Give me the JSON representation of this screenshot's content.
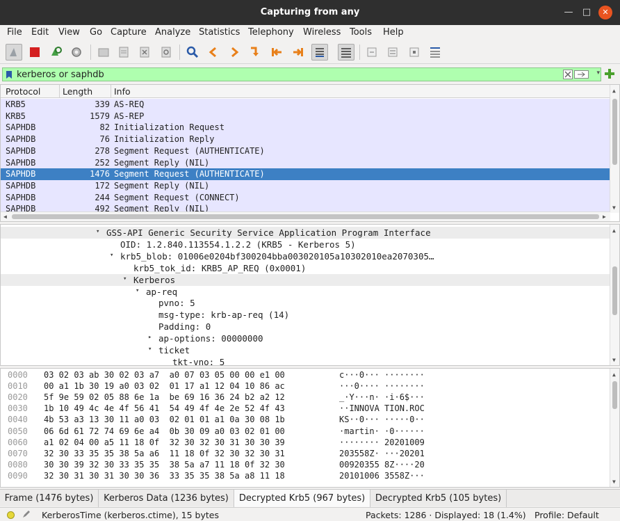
{
  "window": {
    "title": "Capturing from any"
  },
  "menu": [
    "File",
    "Edit",
    "View",
    "Go",
    "Capture",
    "Analyze",
    "Statistics",
    "Telephony",
    "Wireless",
    "Tools",
    "Help"
  ],
  "toolbar": {
    "icons": [
      "shark-fin-icon",
      "stop-icon",
      "restart-icon",
      "options-gear-icon",
      "open-file-icon",
      "save-file-icon",
      "close-file-icon",
      "reload-icon",
      "find-icon",
      "go-back-icon",
      "go-forward-icon",
      "go-to-packet-icon",
      "go-first-icon",
      "go-last-icon",
      "auto-scroll-icon",
      "colorize-icon",
      "zoom-in-icon",
      "zoom-out-icon",
      "zoom-normal-icon",
      "resize-columns-icon"
    ]
  },
  "filter": {
    "value": "kerberos or saphdb"
  },
  "packet_list": {
    "columns": [
      "Protocol",
      "Length",
      "Info"
    ],
    "rows": [
      {
        "protocol": "KRB5",
        "length": "339",
        "info": "AS-REQ",
        "selected": false
      },
      {
        "protocol": "KRB5",
        "length": "1579",
        "info": "AS-REP",
        "selected": false
      },
      {
        "protocol": "SAPHDB",
        "length": "82",
        "info": "Initialization Request",
        "selected": false
      },
      {
        "protocol": "SAPHDB",
        "length": "76",
        "info": "Initialization Reply",
        "selected": false
      },
      {
        "protocol": "SAPHDB",
        "length": "278",
        "info": "Segment Request (AUTHENTICATE)",
        "selected": false
      },
      {
        "protocol": "SAPHDB",
        "length": "252",
        "info": "Segment Reply (NIL)",
        "selected": false
      },
      {
        "protocol": "SAPHDB",
        "length": "1476",
        "info": "Segment Request (AUTHENTICATE)",
        "selected": true
      },
      {
        "protocol": "SAPHDB",
        "length": "172",
        "info": "Segment Reply (NIL)",
        "selected": false
      },
      {
        "protocol": "SAPHDB",
        "length": "244",
        "info": "Segment Request (CONNECT)",
        "selected": false
      },
      {
        "protocol": "SAPHDB",
        "length": "492",
        "info": "Segment Reply (NIL)",
        "selected": false
      }
    ]
  },
  "details": [
    {
      "indent": 0,
      "arrow": "down",
      "text": "GSS-API Generic Security Service Application Program Interface",
      "highlight": true
    },
    {
      "indent": 1,
      "arrow": "",
      "text": "OID: 1.2.840.113554.1.2.2 (KRB5 - Kerberos 5)",
      "highlight": false
    },
    {
      "indent": 1,
      "arrow": "down",
      "text": "krb5_blob: 01006e0204bf300204bba003020105a10302010ea2070305…",
      "highlight": false
    },
    {
      "indent": 2,
      "arrow": "",
      "text": "krb5_tok_id: KRB5_AP_REQ (0x0001)",
      "highlight": false
    },
    {
      "indent": 2,
      "arrow": "down",
      "text": "Kerberos",
      "highlight": true
    },
    {
      "indent": 3,
      "arrow": "down",
      "text": "ap-req",
      "highlight": false
    },
    {
      "indent": 4,
      "arrow": "",
      "text": "pvno: 5",
      "highlight": false
    },
    {
      "indent": 4,
      "arrow": "",
      "text": "msg-type: krb-ap-req (14)",
      "highlight": false
    },
    {
      "indent": 4,
      "arrow": "",
      "text": "Padding: 0",
      "highlight": false
    },
    {
      "indent": 4,
      "arrow": "right",
      "text": "ap-options: 00000000",
      "highlight": false
    },
    {
      "indent": 4,
      "arrow": "down",
      "text": "ticket",
      "highlight": false
    },
    {
      "indent": 5,
      "arrow": "",
      "text": "tkt-vno: 5",
      "highlight": false
    }
  ],
  "bytes": [
    {
      "offset": "0000",
      "hex": "03 02 03 ab 30 02 03 a7  a0 07 03 05 00 00 e1 00",
      "ascii": "c···0··· ········"
    },
    {
      "offset": "0010",
      "hex": "00 a1 1b 30 19 a0 03 02  01 17 a1 12 04 10 86 ac",
      "ascii": "···0···· ········"
    },
    {
      "offset": "0020",
      "hex": "5f 9e 59 02 05 88 6e 1a  be 69 16 36 24 b2 a2 12",
      "ascii": "_·Y···n· ·i·6$···"
    },
    {
      "offset": "0030",
      "hex": "1b 10 49 4c 4e 4f 56 41  54 49 4f 4e 2e 52 4f 43",
      "ascii": "··INNOVA TION.ROC"
    },
    {
      "offset": "0040",
      "hex": "4b 53 a3 13 30 11 a0 03  02 01 01 a1 0a 30 08 1b",
      "ascii": "KS··0··· ·····0··"
    },
    {
      "offset": "0050",
      "hex": "06 6d 61 72 74 69 6e a4  0b 30 09 a0 03 02 01 00",
      "ascii": "·martin· ·0······"
    },
    {
      "offset": "0060",
      "hex": "a1 02 04 00 a5 11 18 0f  32 30 32 30 31 30 30 39",
      "ascii": "········ 20201009"
    },
    {
      "offset": "0070",
      "hex": "32 30 33 35 35 38 5a a6  11 18 0f 32 30 32 30 31",
      "ascii": "203558Z· ···20201"
    },
    {
      "offset": "0080",
      "hex": "30 30 39 32 30 33 35 35  38 5a a7 11 18 0f 32 30",
      "ascii": "00920355 8Z····20"
    },
    {
      "offset": "0090",
      "hex": "32 30 31 30 31 30 30 36  33 35 35 38 5a a8 11 18",
      "ascii": "20101006 3558Z···"
    }
  ],
  "tabs": [
    {
      "label": "Frame (1476 bytes)",
      "active": false
    },
    {
      "label": "Kerberos Data (1236 bytes)",
      "active": false
    },
    {
      "label": "Decrypted Krb5 (967 bytes)",
      "active": true
    },
    {
      "label": "Decrypted Krb5 (105 bytes)",
      "active": false
    }
  ],
  "status": {
    "field": "KerberosTime (kerberos.ctime), 15 bytes",
    "packets": "Packets: 1286 · Displayed: 18 (1.4%)",
    "profile": "Profile: Default"
  },
  "colors": {
    "selected_row": "#3d80c4",
    "packet_bg": "#e7e6ff",
    "filter_ok": "#afffaf"
  }
}
